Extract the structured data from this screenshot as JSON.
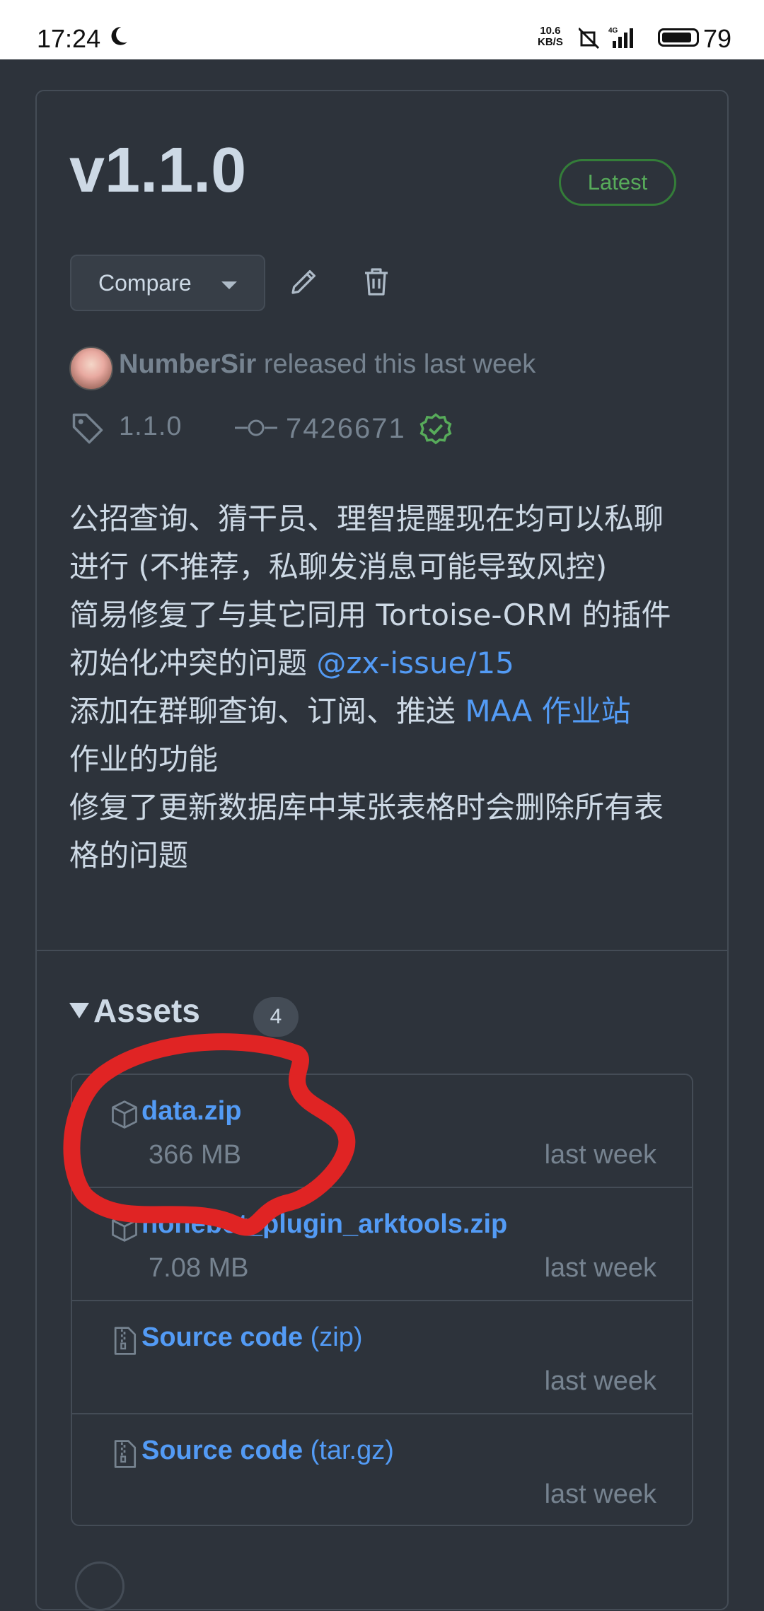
{
  "status_bar": {
    "time": "17:24",
    "net_speed_value": "10.6",
    "net_speed_unit": "KB/S",
    "network": "4G",
    "battery": "79"
  },
  "release": {
    "version": "v1.1.0",
    "badge": "Latest",
    "compare_label": "Compare",
    "author": "NumberSir",
    "released_text": "released this last week",
    "tag": "1.1.0",
    "commit": "7426671"
  },
  "notes": {
    "line1": "公招查询、猜干员、理智提醒现在均可以私聊进行 (不推荐，私聊发消息可能导致风控)",
    "line2_prefix": "简易修复了与其它同用 Tortoise-ORM 的插件初始化冲突的问题 ",
    "line2_link": "@zx-issue/15",
    "line3_prefix": "添加在群聊查询、订阅、推送 ",
    "line3_link": "MAA 作业站",
    "line3_suffix": "作业的功能",
    "line4": "修复了更新数据库中某张表格时会删除所有表格的问题"
  },
  "assets": {
    "title": "Assets",
    "count": "4",
    "items": [
      {
        "name": "data.zip",
        "suffix": "",
        "size": "366 MB",
        "date": "last week",
        "icon": "package-icon"
      },
      {
        "name": "nonebot_plugin_arktools.zip",
        "suffix": "",
        "size": "7.08 MB",
        "date": "last week",
        "icon": "package-icon"
      },
      {
        "name": "Source code",
        "suffix": "(zip)",
        "size": "",
        "date": "last week",
        "icon": "file-zip-icon"
      },
      {
        "name": "Source code",
        "suffix": "(tar.gz)",
        "size": "",
        "date": "last week",
        "icon": "file-zip-icon"
      }
    ]
  },
  "colors": {
    "background": "#2d333b",
    "link": "#539bf5",
    "latest_green": "#57ab5a",
    "annotation_red": "#e02424"
  }
}
